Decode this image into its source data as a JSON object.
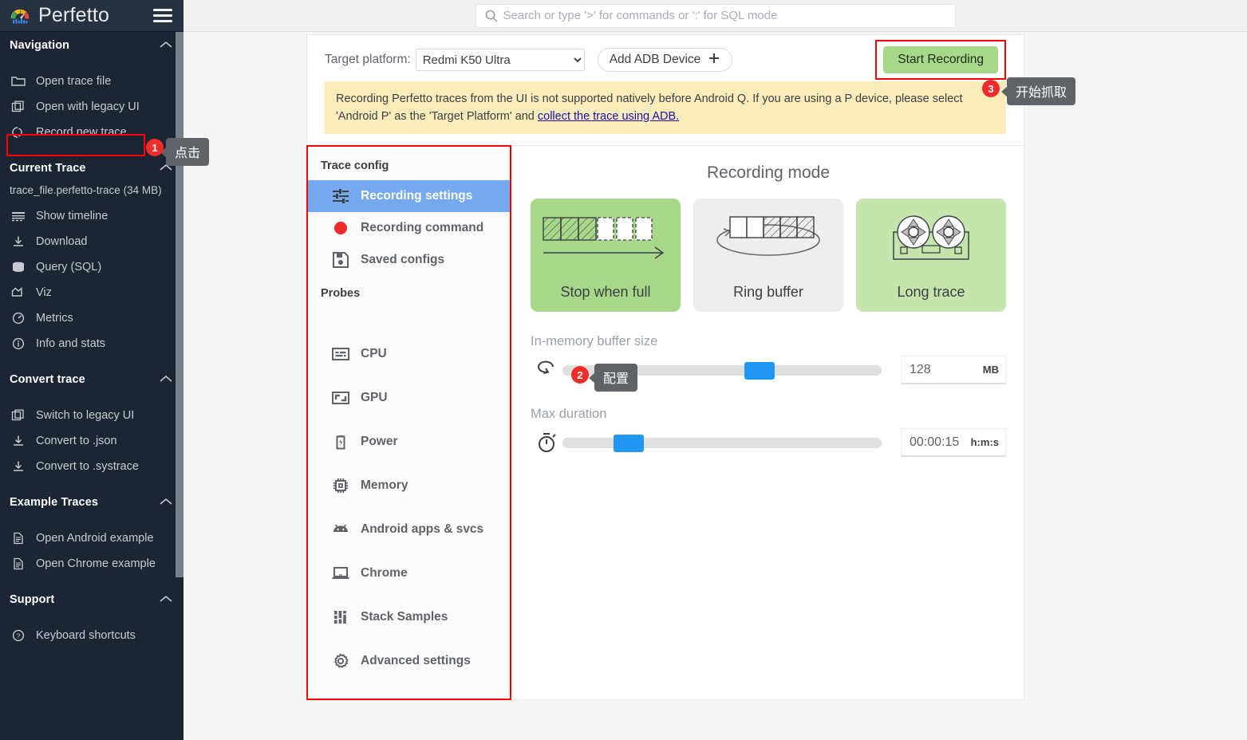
{
  "app": {
    "brand": "Perfetto",
    "menu_icon": "hamburger-icon"
  },
  "search": {
    "placeholder": "Search or type '>' for commands or ':' for SQL mode",
    "value": "",
    "icon": "search-icon"
  },
  "sidebar": {
    "sections": [
      {
        "title": "Navigation",
        "items": [
          {
            "label": "Open trace file",
            "icon": "folder-open-icon"
          },
          {
            "label": "Open with legacy UI",
            "icon": "copy-icon"
          },
          {
            "label": "Record new trace",
            "icon": "record-icon"
          }
        ]
      },
      {
        "title": "Current Trace",
        "trace_file": "trace_file.perfetto-trace (34 MB)",
        "items": [
          {
            "label": "Show timeline",
            "icon": "timeline-icon"
          },
          {
            "label": "Download",
            "icon": "download-icon"
          },
          {
            "label": "Query (SQL)",
            "icon": "database-icon"
          },
          {
            "label": "Viz",
            "icon": "chart-icon"
          },
          {
            "label": "Metrics",
            "icon": "speedometer-icon"
          },
          {
            "label": "Info and stats",
            "icon": "info-icon"
          }
        ]
      },
      {
        "title": "Convert trace",
        "items": [
          {
            "label": "Switch to legacy UI",
            "icon": "copy-icon"
          },
          {
            "label": "Convert to .json",
            "icon": "download-icon"
          },
          {
            "label": "Convert to .systrace",
            "icon": "download-icon"
          }
        ]
      },
      {
        "title": "Example Traces",
        "items": [
          {
            "label": "Open Android example",
            "icon": "document-icon"
          },
          {
            "label": "Open Chrome example",
            "icon": "document-icon"
          }
        ]
      },
      {
        "title": "Support",
        "items": [
          {
            "label": "Keyboard shortcuts",
            "icon": "help-circle-icon"
          }
        ]
      }
    ],
    "collapse_icon": "chevron-up-icon"
  },
  "callouts": [
    {
      "number": "1",
      "text": "点击"
    },
    {
      "number": "2",
      "text": "配置"
    },
    {
      "number": "3",
      "text": "开始抓取"
    }
  ],
  "record_page": {
    "target_platform_label": "Target platform:",
    "target_platform_value": "Redmi K50 Ultra",
    "target_platform_options": [
      "Redmi K50 Ultra"
    ],
    "add_adb_label": "Add ADB Device",
    "add_adb_icon": "plus-icon",
    "start_recording_label": "Start Recording",
    "warning": {
      "text_before_link": "Recording Perfetto traces from the UI is not supported natively before Android Q. If you are using a P device, please select 'Android P' as the 'Target Platform' and ",
      "link_text": "collect the trace using ADB.",
      "text_after_link": ""
    },
    "trace_config": {
      "heading": "Trace config",
      "items": [
        {
          "label": "Recording settings",
          "icon": "tune-icon",
          "selected": true
        },
        {
          "label": "Recording command",
          "icon": "red-dot-icon",
          "selected": false
        },
        {
          "label": "Saved configs",
          "icon": "save-icon",
          "selected": false
        }
      ],
      "probes_heading": "Probes",
      "probes": [
        {
          "label": "CPU",
          "icon": "cpu-icon"
        },
        {
          "label": "GPU",
          "icon": "gpu-icon"
        },
        {
          "label": "Power",
          "icon": "battery-icon"
        },
        {
          "label": "Memory",
          "icon": "memory-chip-icon"
        },
        {
          "label": "Android apps & svcs",
          "icon": "android-icon"
        },
        {
          "label": "Chrome",
          "icon": "laptop-icon"
        },
        {
          "label": "Stack Samples",
          "icon": "bars-icon"
        },
        {
          "label": "Advanced settings",
          "icon": "gear-icon"
        }
      ]
    },
    "recording_mode": {
      "title": "Recording mode",
      "modes": [
        {
          "label": "Stop when full",
          "icon": "buffer-linear-icon",
          "state": "selected"
        },
        {
          "label": "Ring buffer",
          "icon": "buffer-ring-icon",
          "state": "inactive"
        },
        {
          "label": "Long trace",
          "icon": "tape-reel-icon",
          "state": "hover"
        }
      ]
    },
    "buffer_slider": {
      "title": "In-memory buffer size",
      "icon": "loop-icon",
      "value": "128",
      "unit": "MB",
      "percent": 57
    },
    "duration_slider": {
      "title": "Max duration",
      "icon": "stopwatch-icon",
      "value": "00:00:15",
      "unit": "h:m:s",
      "percent": 16
    }
  },
  "colors": {
    "sidebar_bg": "#1c2533",
    "accent_blue": "#74a9ef",
    "slider_blue": "#2196f3",
    "green_selected": "#a8d88a",
    "green_hover": "#c6e5ad",
    "warning_bg": "#faedbb",
    "callout_red": "#ef2b2b",
    "highlight_border": "#ff0000"
  }
}
